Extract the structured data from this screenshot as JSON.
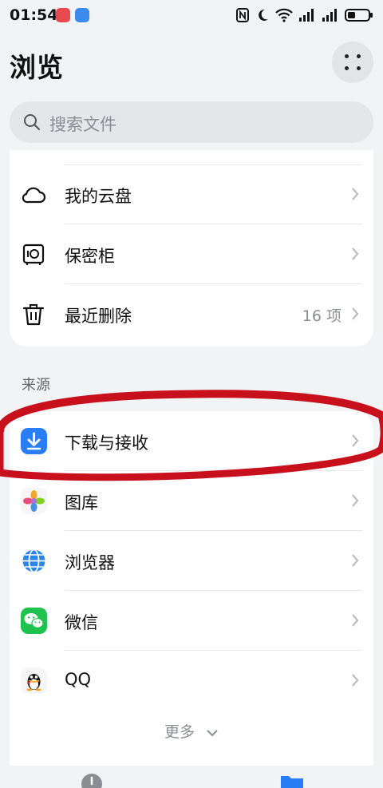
{
  "status_bar": {
    "time": "01:54",
    "icons": [
      "nfc-icon",
      "moon-icon",
      "wifi-icon",
      "signal-icon",
      "signal-icon",
      "battery-icon"
    ]
  },
  "header": {
    "title": "浏览",
    "more_icon": "more-dots-icon"
  },
  "search": {
    "placeholder": "搜索文件",
    "icon": "search-icon"
  },
  "locations": [
    {
      "label": "我的云盘",
      "icon": "cloud-icon"
    },
    {
      "label": "保密柜",
      "icon": "safe-icon"
    },
    {
      "label": "最近删除",
      "icon": "trash-icon",
      "count": "16 项"
    }
  ],
  "sources_section": {
    "title": "来源",
    "items": [
      {
        "label": "下载与接收",
        "icon": "download-icon"
      },
      {
        "label": "图库",
        "icon": "gallery-icon"
      },
      {
        "label": "浏览器",
        "icon": "browser-icon"
      },
      {
        "label": "微信",
        "icon": "wechat-icon"
      },
      {
        "label": "QQ",
        "icon": "qq-icon"
      }
    ],
    "show_more": "更多"
  },
  "bottom_nav": {
    "tabs": [
      {
        "icon": "clock-icon"
      },
      {
        "icon": "folder-icon"
      }
    ]
  },
  "colors": {
    "background": "#f1f3f5",
    "card": "#ffffff",
    "annotation_red": "#c8101d",
    "accent_blue": "#2a7ef5"
  }
}
